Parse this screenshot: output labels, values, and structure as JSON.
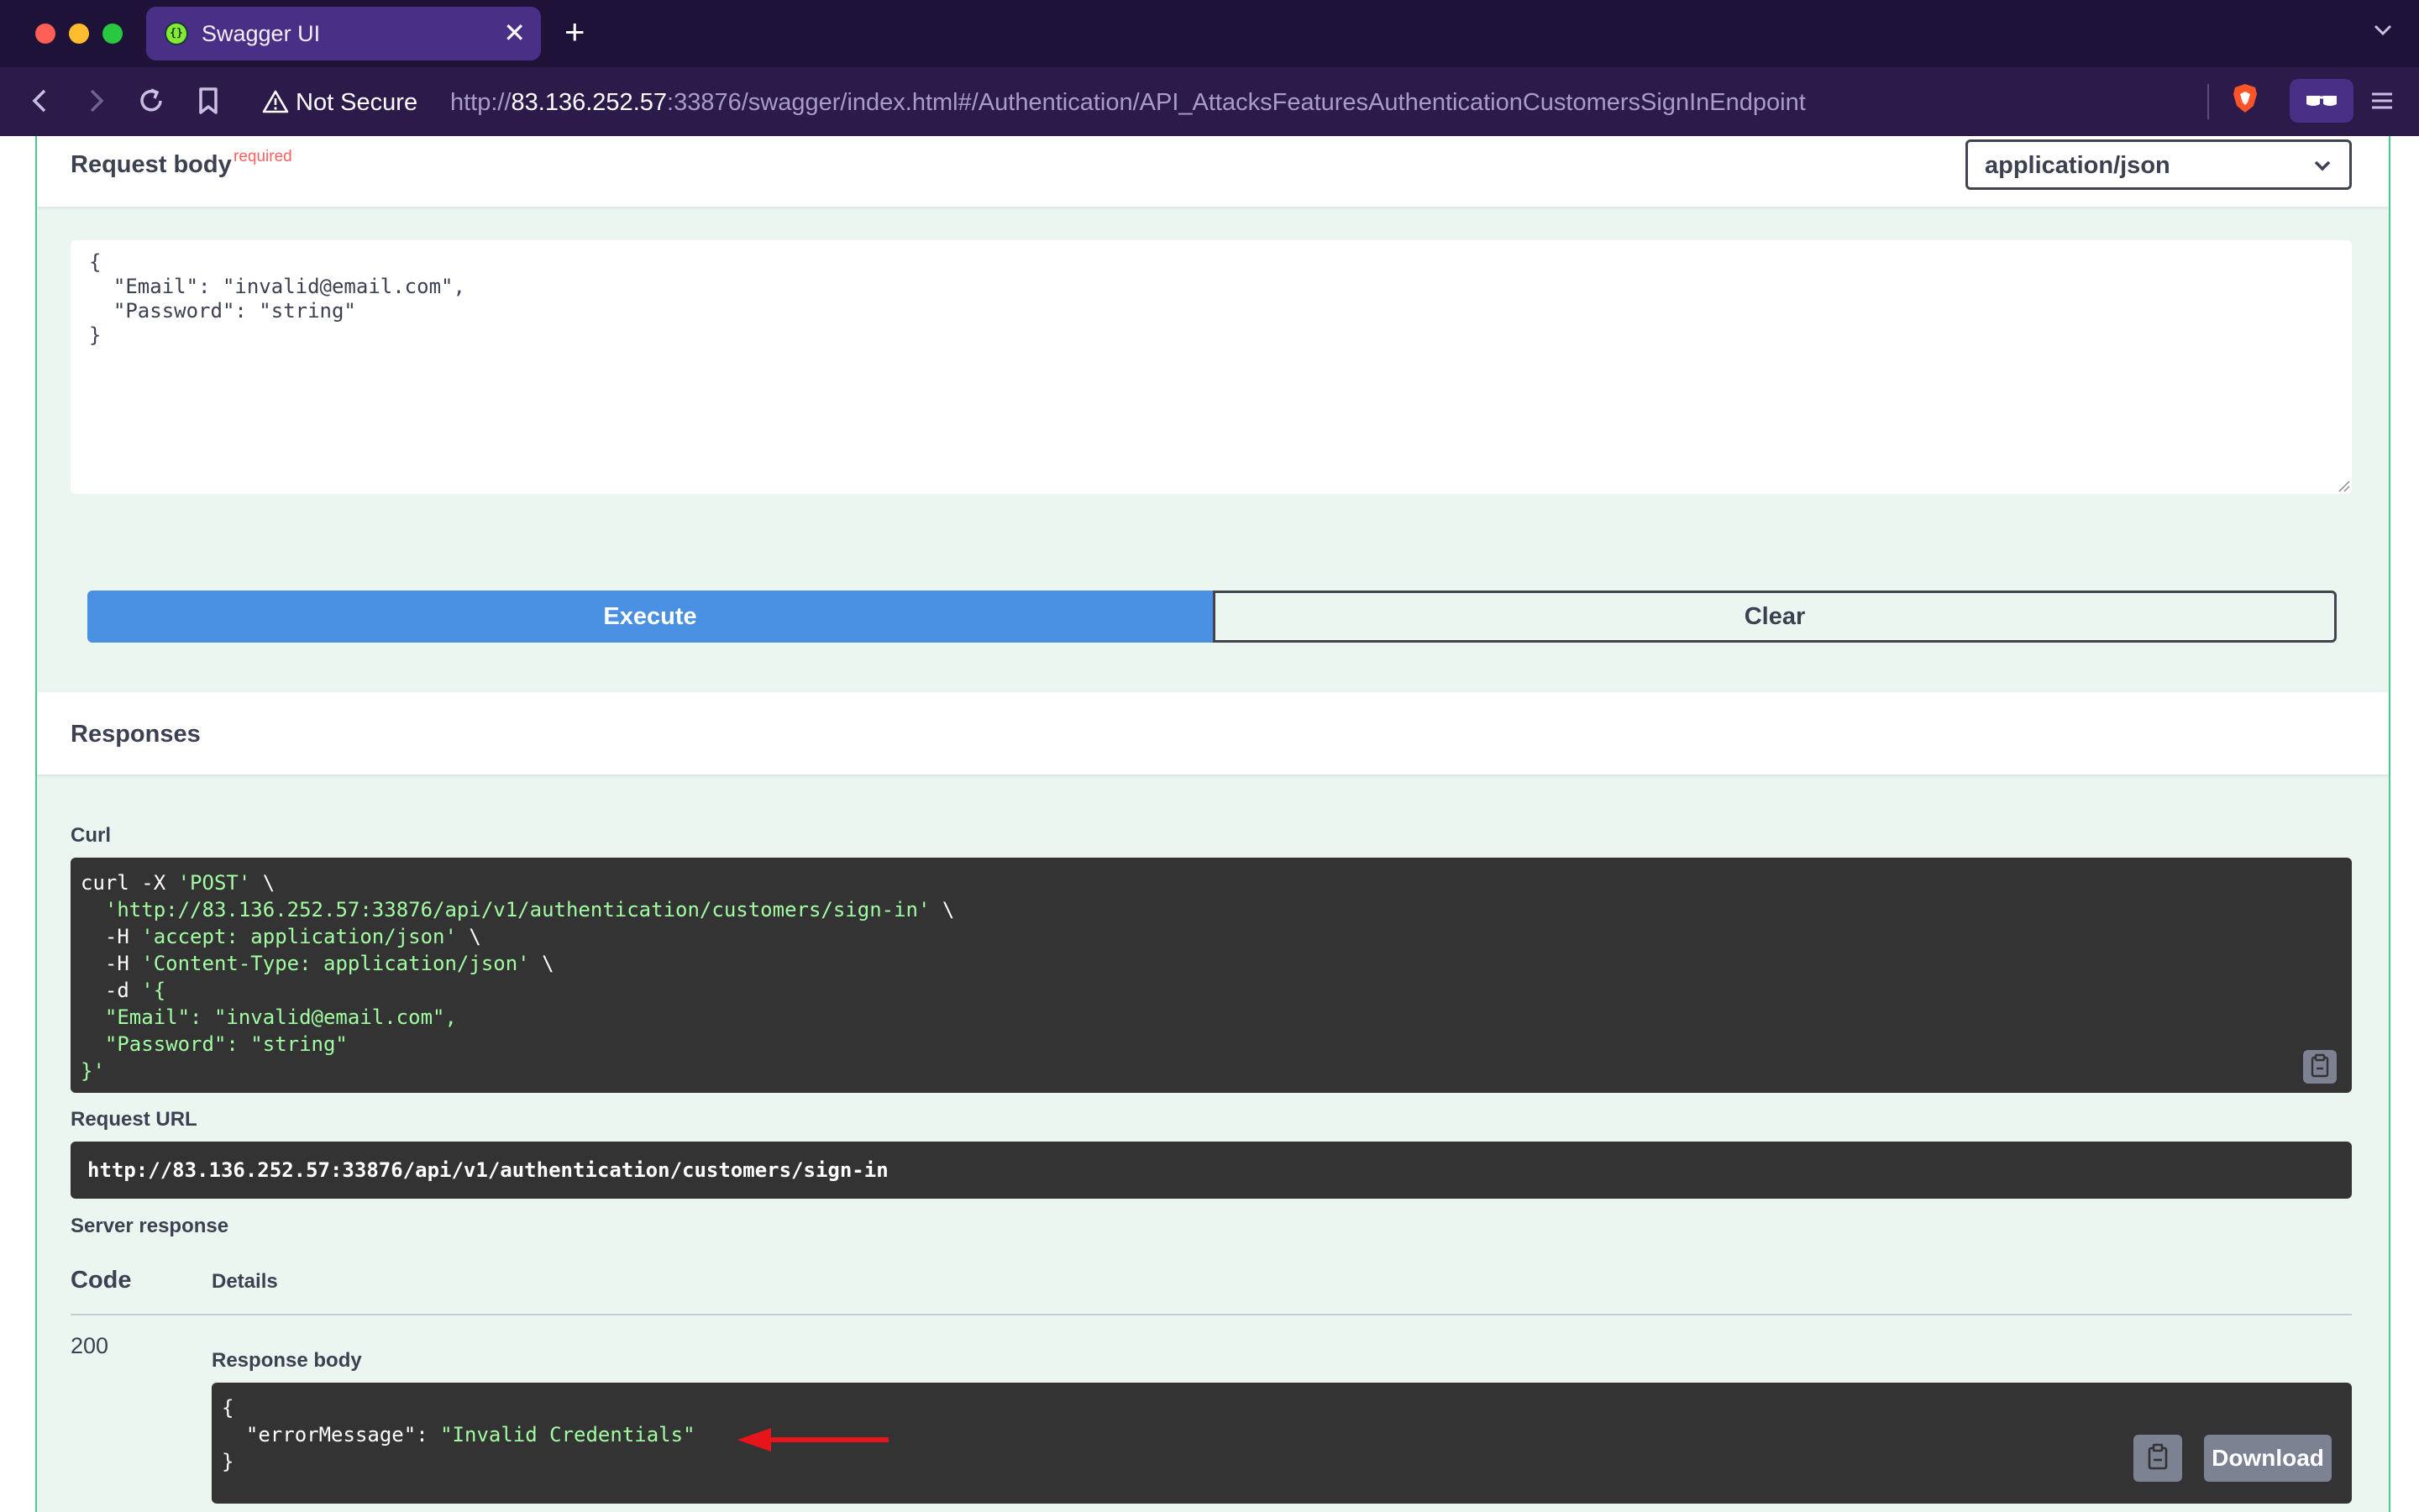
{
  "browser": {
    "tab": {
      "title": "Swagger UI",
      "favicon": "swagger-logo-icon",
      "close": "✕"
    },
    "new_tab": "+",
    "address": {
      "security_label": "Not Secure",
      "url_scheme": "http://",
      "url_host": "83.136.252.57",
      "url_rest": ":33876/swagger/index.html#/Authentication/API_AttacksFeaturesAuthenticationCustomersSignInEndpoint"
    },
    "colors": {
      "chrome": "#2b1a4a",
      "tab_active": "#4a2f86"
    }
  },
  "request_body": {
    "title": "Request body",
    "required_label": "required",
    "content_type": "application/json",
    "value": "{\n  \"Email\": \"invalid@email.com\",\n  \"Password\": \"string\"\n}"
  },
  "actions": {
    "execute_label": "Execute",
    "clear_label": "Clear"
  },
  "responses": {
    "title": "Responses",
    "curl_label": "Curl",
    "curl_lines": [
      {
        "plain": "curl -X ",
        "str": "'POST'",
        "tail": " \\"
      },
      {
        "plain": "  ",
        "str": "'http://83.136.252.57:33876/api/v1/authentication/customers/sign-in'",
        "tail": " \\"
      },
      {
        "plain": "  -H ",
        "str": "'accept: application/json'",
        "tail": " \\"
      },
      {
        "plain": "  -H ",
        "str": "'Content-Type: application/json'",
        "tail": " \\"
      },
      {
        "plain": "  -d ",
        "str": "'{",
        "tail": ""
      },
      {
        "plain": "",
        "str": "  \"Email\": \"invalid@email.com\",",
        "tail": ""
      },
      {
        "plain": "",
        "str": "  \"Password\": \"string\"",
        "tail": ""
      },
      {
        "plain": "",
        "str": "}'",
        "tail": ""
      }
    ],
    "request_url_label": "Request URL",
    "request_url": "http://83.136.252.57:33876/api/v1/authentication/customers/sign-in",
    "server_response_label": "Server response",
    "col_code": "Code",
    "col_details": "Details",
    "code": "200",
    "response_body_label": "Response body",
    "body_open": "{",
    "body_key": "  \"errorMessage\": ",
    "body_value": "\"Invalid Credentials\"",
    "body_close": "}",
    "download_label": "Download",
    "accent_color": "#49cc90",
    "execute_color": "#4990e2",
    "annotation_arrow_color": "#e8141b"
  }
}
